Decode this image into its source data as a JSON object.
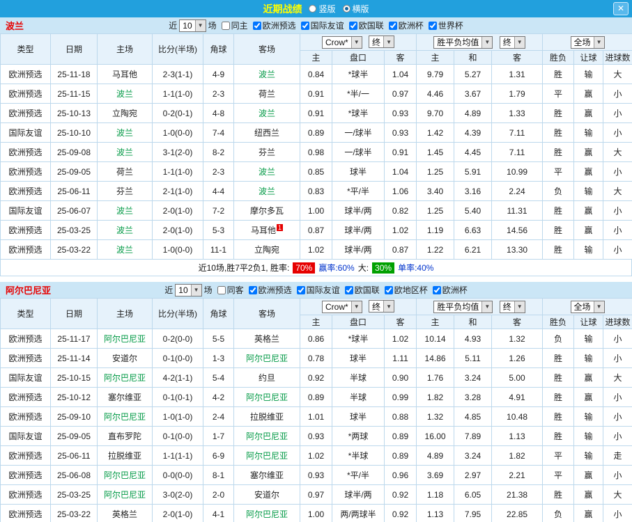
{
  "titlebar": {
    "title": "近期战绩",
    "vertical_label": "竖版",
    "vertical_selected": false,
    "horizontal_label": "横版",
    "horizontal_selected": true,
    "close": "✕"
  },
  "sub_columns": [
    "主",
    "盘口",
    "客",
    "主",
    "和",
    "客",
    "胜负",
    "让球",
    "进球数"
  ],
  "colors": {
    "titlebar_bg": "#22a0dd",
    "title_text": "#ffff00",
    "filter_bg": "#cbe6f6",
    "header_bg": "#e6f2fb",
    "grid_border": "#bcd8ec",
    "qual_bg": "#970042",
    "friendly_bg": "#3c5ab8",
    "focus_team": "#009944",
    "odds": "#23408f",
    "red": "#e60000",
    "green": "#009944",
    "blue": "#0033cc",
    "win_rate_bg": "#e60000",
    "big_rate_bg": "#00a000"
  },
  "sections": [
    {
      "team": "波兰",
      "filters": {
        "recent_label": "近",
        "count_value": "10",
        "matches_label": "场",
        "checkboxes": [
          {
            "label": "同主",
            "checked": false
          },
          {
            "label": "欧洲预选",
            "checked": true
          },
          {
            "label": "国际友谊",
            "checked": true
          },
          {
            "label": "欧国联",
            "checked": true
          },
          {
            "label": "欧洲杯",
            "checked": true
          },
          {
            "label": "世界杯",
            "checked": true
          }
        ]
      },
      "header": {
        "type": "类型",
        "date": "日期",
        "home": "主场",
        "score": "比分(半场)",
        "corner": "角球",
        "away": "客场",
        "odds_company": "Crow*",
        "odds_final": "终",
        "wdl_label": "胜平负均值",
        "wdl_final": "终",
        "scope": "全场"
      },
      "rows": [
        {
          "comp": "欧洲预选",
          "comp_style": "qual",
          "date": "25-11-18",
          "home": "马耳他",
          "home_focus": false,
          "score": "2-3(1-1)",
          "corners": "4-9",
          "away": "波兰",
          "away_focus": true,
          "home_odds": "0.84",
          "handicap": "*球半",
          "away_odds": "1.04",
          "win": "9.79",
          "draw": "5.27",
          "lose": "1.31",
          "result": "胜",
          "result_c": "r",
          "cover": "输",
          "cover_c": "g",
          "goals": "大",
          "goals_c": "r"
        },
        {
          "comp": "欧洲预选",
          "comp_style": "qual",
          "date": "25-11-15",
          "home": "波兰",
          "home_focus": true,
          "score": "1-1(1-0)",
          "corners": "2-3",
          "away": "荷兰",
          "away_focus": false,
          "home_odds": "0.91",
          "handicap": "*半/一",
          "away_odds": "0.97",
          "win": "4.46",
          "draw": "3.67",
          "lose": "1.79",
          "result": "平",
          "result_c": "b",
          "cover": "赢",
          "cover_c": "r",
          "goals": "小",
          "goals_c": "r"
        },
        {
          "comp": "欧洲预选",
          "comp_style": "qual",
          "date": "25-10-13",
          "home": "立陶宛",
          "home_focus": false,
          "score": "0-2(0-1)",
          "corners": "4-8",
          "away": "波兰",
          "away_focus": true,
          "home_odds": "0.91",
          "handicap": "*球半",
          "away_odds": "0.93",
          "win": "9.70",
          "draw": "4.89",
          "lose": "1.33",
          "result": "胜",
          "result_c": "r",
          "cover": "赢",
          "cover_c": "r",
          "goals": "小",
          "goals_c": "r"
        },
        {
          "comp": "国际友谊",
          "comp_style": "friendly",
          "date": "25-10-10",
          "home": "波兰",
          "home_focus": true,
          "score": "1-0(0-0)",
          "corners": "7-4",
          "away": "纽西兰",
          "away_focus": false,
          "home_odds": "0.89",
          "handicap": "一/球半",
          "away_odds": "0.93",
          "win": "1.42",
          "draw": "4.39",
          "lose": "7.11",
          "result": "胜",
          "result_c": "r",
          "cover": "输",
          "cover_c": "g",
          "goals": "小",
          "goals_c": "r"
        },
        {
          "comp": "欧洲预选",
          "comp_style": "qual",
          "date": "25-09-08",
          "home": "波兰",
          "home_focus": true,
          "score": "3-1(2-0)",
          "corners": "8-2",
          "away": "芬兰",
          "away_focus": false,
          "home_odds": "0.98",
          "handicap": "一/球半",
          "away_odds": "0.91",
          "win": "1.45",
          "draw": "4.45",
          "lose": "7.11",
          "result": "胜",
          "result_c": "r",
          "cover": "赢",
          "cover_c": "r",
          "goals": "大",
          "goals_c": "r"
        },
        {
          "comp": "欧洲预选",
          "comp_style": "qual",
          "date": "25-09-05",
          "home": "荷兰",
          "home_focus": false,
          "score": "1-1(1-0)",
          "corners": "2-3",
          "away": "波兰",
          "away_focus": true,
          "home_odds": "0.85",
          "handicap": "球半",
          "away_odds": "1.04",
          "win": "1.25",
          "draw": "5.91",
          "lose": "10.99",
          "result": "平",
          "result_c": "b",
          "cover": "赢",
          "cover_c": "r",
          "goals": "小",
          "goals_c": "r"
        },
        {
          "comp": "欧洲预选",
          "comp_style": "qual",
          "date": "25-06-11",
          "home": "芬兰",
          "home_focus": false,
          "score": "2-1(1-0)",
          "corners": "4-4",
          "away": "波兰",
          "away_focus": true,
          "home_odds": "0.83",
          "handicap": "*平/半",
          "away_odds": "1.06",
          "win": "3.40",
          "draw": "3.16",
          "lose": "2.24",
          "result": "负",
          "result_c": "g",
          "cover": "输",
          "cover_c": "g",
          "goals": "大",
          "goals_c": "r"
        },
        {
          "comp": "国际友谊",
          "comp_style": "friendly",
          "date": "25-06-07",
          "home": "波兰",
          "home_focus": true,
          "score": "2-0(1-0)",
          "corners": "7-2",
          "away": "摩尔多瓦",
          "away_focus": false,
          "home_odds": "1.00",
          "handicap": "球半/两",
          "away_odds": "0.82",
          "win": "1.25",
          "draw": "5.40",
          "lose": "11.31",
          "result": "胜",
          "result_c": "r",
          "cover": "赢",
          "cover_c": "r",
          "goals": "小",
          "goals_c": "r"
        },
        {
          "comp": "欧洲预选",
          "comp_style": "qual",
          "date": "25-03-25",
          "home": "波兰",
          "home_focus": true,
          "score": "2-0(1-0)",
          "corners": "5-3",
          "away": "马耳他",
          "away_focus": false,
          "away_badge": "1",
          "home_odds": "0.87",
          "handicap": "球半/两",
          "away_odds": "1.02",
          "win": "1.19",
          "draw": "6.63",
          "lose": "14.56",
          "result": "胜",
          "result_c": "r",
          "cover": "赢",
          "cover_c": "r",
          "goals": "小",
          "goals_c": "r"
        },
        {
          "comp": "欧洲预选",
          "comp_style": "qual",
          "date": "25-03-22",
          "home": "波兰",
          "home_focus": true,
          "score": "1-0(0-0)",
          "corners": "11-1",
          "away": "立陶宛",
          "away_focus": false,
          "home_odds": "1.02",
          "handicap": "球半/两",
          "away_odds": "0.87",
          "win": "1.22",
          "draw": "6.21",
          "lose": "13.30",
          "result": "胜",
          "result_c": "r",
          "cover": "输",
          "cover_c": "g",
          "goals": "小",
          "goals_c": "r"
        }
      ],
      "summary": {
        "prefix": "近10场,胜7平2负1, 胜率:",
        "win_rate": "70%",
        "mid": "赢率:60%",
        "big_label": "大:",
        "big_rate": "30%",
        "suffix": "单率:40%"
      }
    },
    {
      "team": "阿尔巴尼亚",
      "filters": {
        "recent_label": "近",
        "count_value": "10",
        "matches_label": "场",
        "checkboxes": [
          {
            "label": "同客",
            "checked": false
          },
          {
            "label": "欧洲预选",
            "checked": true
          },
          {
            "label": "国际友谊",
            "checked": true
          },
          {
            "label": "欧国联",
            "checked": true
          },
          {
            "label": "欧地区杯",
            "checked": true
          },
          {
            "label": "欧洲杯",
            "checked": true
          }
        ]
      },
      "header": {
        "type": "类型",
        "date": "日期",
        "home": "主场",
        "score": "比分(半场)",
        "corner": "角球",
        "away": "客场",
        "odds_company": "Crow*",
        "odds_final": "终",
        "wdl_label": "胜平负均值",
        "wdl_final": "终",
        "scope": "全场"
      },
      "rows": [
        {
          "comp": "欧洲预选",
          "comp_style": "qual",
          "date": "25-11-17",
          "home": "阿尔巴尼亚",
          "home_focus": true,
          "score": "0-2(0-0)",
          "corners": "5-5",
          "away": "英格兰",
          "away_focus": false,
          "home_odds": "0.86",
          "handicap": "*球半",
          "away_odds": "1.02",
          "win": "10.14",
          "draw": "4.93",
          "lose": "1.32",
          "result": "负",
          "result_c": "g",
          "cover": "输",
          "cover_c": "g",
          "goals": "小",
          "goals_c": "r"
        },
        {
          "comp": "欧洲预选",
          "comp_style": "qual",
          "date": "25-11-14",
          "home": "安道尔",
          "home_focus": false,
          "score": "0-1(0-0)",
          "corners": "1-3",
          "away": "阿尔巴尼亚",
          "away_focus": true,
          "home_odds": "0.78",
          "handicap": "球半",
          "away_odds": "1.11",
          "win": "14.86",
          "draw": "5.11",
          "lose": "1.26",
          "result": "胜",
          "result_c": "r",
          "cover": "输",
          "cover_c": "g",
          "goals": "小",
          "goals_c": "r"
        },
        {
          "comp": "国际友谊",
          "comp_style": "friendly",
          "date": "25-10-15",
          "home": "阿尔巴尼亚",
          "home_focus": true,
          "score": "4-2(1-1)",
          "corners": "5-4",
          "away": "约旦",
          "away_focus": false,
          "home_odds": "0.92",
          "handicap": "半球",
          "away_odds": "0.90",
          "win": "1.76",
          "draw": "3.24",
          "lose": "5.00",
          "result": "胜",
          "result_c": "r",
          "cover": "赢",
          "cover_c": "r",
          "goals": "大",
          "goals_c": "r"
        },
        {
          "comp": "欧洲预选",
          "comp_style": "qual",
          "date": "25-10-12",
          "home": "塞尔维亚",
          "home_focus": false,
          "score": "0-1(0-1)",
          "corners": "4-2",
          "away": "阿尔巴尼亚",
          "away_focus": true,
          "home_odds": "0.89",
          "handicap": "半球",
          "away_odds": "0.99",
          "win": "1.82",
          "draw": "3.28",
          "lose": "4.91",
          "result": "胜",
          "result_c": "r",
          "cover": "赢",
          "cover_c": "r",
          "goals": "小",
          "goals_c": "r"
        },
        {
          "comp": "欧洲预选",
          "comp_style": "qual",
          "date": "25-09-10",
          "home": "阿尔巴尼亚",
          "home_focus": true,
          "score": "1-0(1-0)",
          "corners": "2-4",
          "away": "拉脱维亚",
          "away_focus": false,
          "home_odds": "1.01",
          "handicap": "球半",
          "away_odds": "0.88",
          "win": "1.32",
          "draw": "4.85",
          "lose": "10.48",
          "result": "胜",
          "result_c": "r",
          "cover": "输",
          "cover_c": "g",
          "goals": "小",
          "goals_c": "r"
        },
        {
          "comp": "国际友谊",
          "comp_style": "friendly",
          "date": "25-09-05",
          "home": "直布罗陀",
          "home_focus": false,
          "score": "0-1(0-0)",
          "corners": "1-7",
          "away": "阿尔巴尼亚",
          "away_focus": true,
          "home_odds": "0.93",
          "handicap": "*两球",
          "away_odds": "0.89",
          "win": "16.00",
          "draw": "7.89",
          "lose": "1.13",
          "result": "胜",
          "result_c": "r",
          "cover": "输",
          "cover_c": "g",
          "goals": "小",
          "goals_c": "r"
        },
        {
          "comp": "欧洲预选",
          "comp_style": "qual",
          "date": "25-06-11",
          "home": "拉脱维亚",
          "home_focus": false,
          "score": "1-1(1-1)",
          "corners": "6-9",
          "away": "阿尔巴尼亚",
          "away_focus": true,
          "home_odds": "1.02",
          "handicap": "*半球",
          "away_odds": "0.89",
          "win": "4.89",
          "draw": "3.24",
          "lose": "1.82",
          "result": "平",
          "result_c": "b",
          "cover": "输",
          "cover_c": "g",
          "goals": "走",
          "goals_c": "b"
        },
        {
          "comp": "欧洲预选",
          "comp_style": "qual",
          "date": "25-06-08",
          "home": "阿尔巴尼亚",
          "home_focus": true,
          "score": "0-0(0-0)",
          "corners": "8-1",
          "away": "塞尔维亚",
          "away_focus": false,
          "home_odds": "0.93",
          "handicap": "*平/半",
          "away_odds": "0.96",
          "win": "3.69",
          "draw": "2.97",
          "lose": "2.21",
          "result": "平",
          "result_c": "b",
          "cover": "赢",
          "cover_c": "r",
          "goals": "小",
          "goals_c": "r"
        },
        {
          "comp": "欧洲预选",
          "comp_style": "qual",
          "date": "25-03-25",
          "home": "阿尔巴尼亚",
          "home_focus": true,
          "score": "3-0(2-0)",
          "corners": "2-0",
          "away": "安道尔",
          "away_focus": false,
          "home_odds": "0.97",
          "handicap": "球半/两",
          "away_odds": "0.92",
          "win": "1.18",
          "draw": "6.05",
          "lose": "21.38",
          "result": "胜",
          "result_c": "r",
          "cover": "赢",
          "cover_c": "r",
          "goals": "大",
          "goals_c": "r"
        },
        {
          "comp": "欧洲预选",
          "comp_style": "qual",
          "date": "25-03-22",
          "home": "英格兰",
          "home_focus": false,
          "score": "2-0(1-0)",
          "corners": "4-1",
          "away": "阿尔巴尼亚",
          "away_focus": true,
          "home_odds": "1.00",
          "handicap": "两/两球半",
          "away_odds": "0.92",
          "win": "1.13",
          "draw": "7.95",
          "lose": "22.85",
          "result": "负",
          "result_c": "g",
          "cover": "赢",
          "cover_c": "r",
          "goals": "小",
          "goals_c": "r"
        }
      ]
    }
  ]
}
